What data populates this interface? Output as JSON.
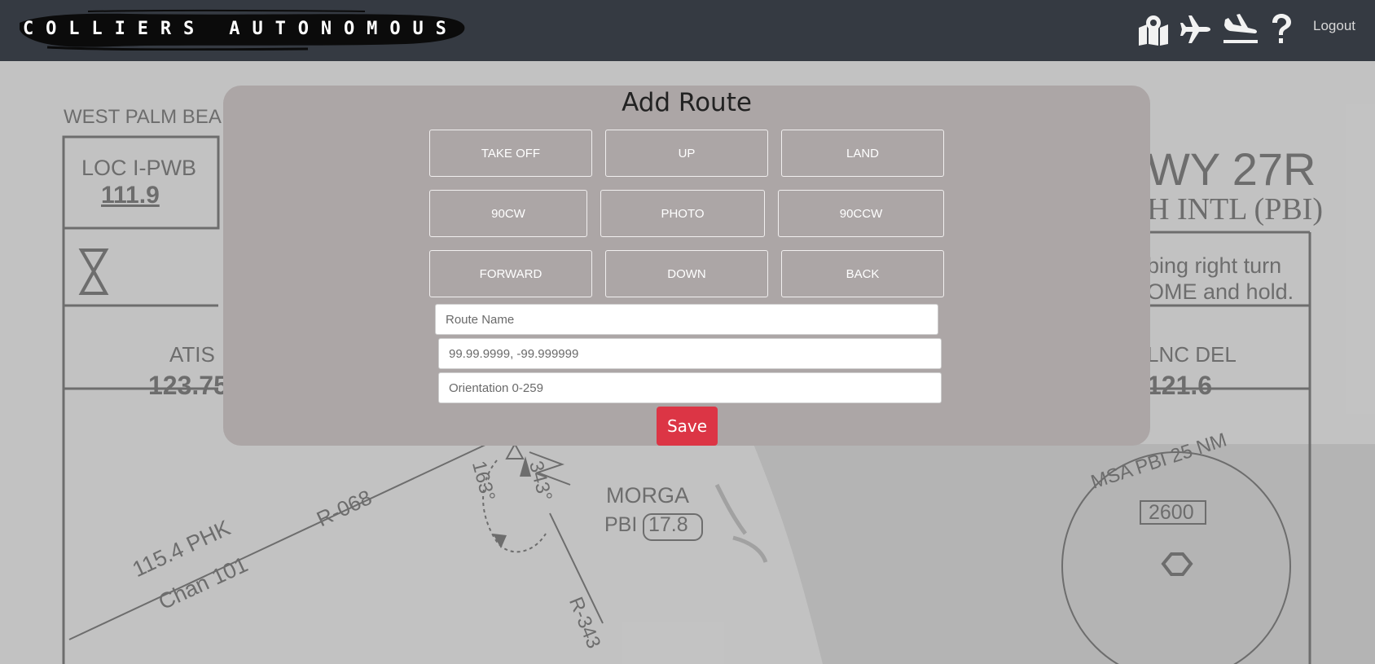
{
  "header": {
    "brand": "COLLIERS AUTONOMOUS",
    "logout_label": "Logout",
    "icons": [
      "map-icon",
      "airplane-icon",
      "landing-icon",
      "help-icon"
    ]
  },
  "background_chart": {
    "title_left": "WEST PALM BEA",
    "loc_label": "LOC  I-PWB",
    "loc_freq": "111.9",
    "runway_title": "WY 27R",
    "airport": "H INTL (PBI)",
    "note_line1": "bing right turn",
    "note_line2": "OME and hold.",
    "atis_label": "ATIS",
    "atis_freq": "123.75",
    "clnc_label": "LNC DEL",
    "clnc_freq": "121.6",
    "fix_name": "MORGA",
    "fix_sub": "PBI",
    "fix_dist": "17.8",
    "radial_068": "R-068",
    "vor_line1": "115.4  PHK",
    "vor_line2": "Chan 101",
    "course_163": "163°",
    "course_343": "343°",
    "radial_343": "R-343",
    "msa": "MSA PBI 25 NM",
    "msa_alt": "2600"
  },
  "modal": {
    "title": "Add Route",
    "buttons_row1": [
      "TAKE OFF",
      "UP",
      "LAND"
    ],
    "buttons_row2": [
      "90CW",
      "PHOTO",
      "90CCW"
    ],
    "buttons_row3": [
      "FORWARD",
      "DOWN",
      "BACK"
    ],
    "route_name_placeholder": "Route Name",
    "coords_placeholder": "99.99.9999, -99.999999",
    "orientation_placeholder": "Orientation 0-259",
    "save_label": "Save"
  },
  "colors": {
    "navbar": "#353a42",
    "modal_bg": "#aca6a6",
    "save_button": "#dc3545"
  }
}
